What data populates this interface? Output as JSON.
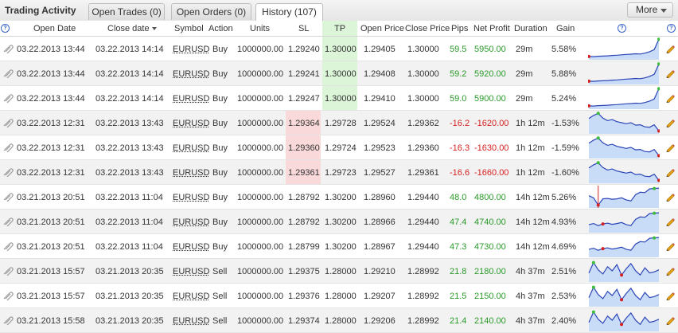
{
  "app": {
    "title": "Trading Activity"
  },
  "tabs": [
    {
      "label": "Open Trades (0)",
      "active": false
    },
    {
      "label": "Open Orders (0)",
      "active": false
    },
    {
      "label": "History (107)",
      "active": true
    }
  ],
  "more_button": {
    "label": "More"
  },
  "columns": {
    "open_date": "Open Date",
    "close_date": "Close date",
    "symbol": "Symbol",
    "action": "Action",
    "units": "Units",
    "sl": "SL",
    "tp": "TP",
    "open_price": "Open Price",
    "close_price": "Close Price",
    "pips": "Pips",
    "net_profit": "Net Profit",
    "duration": "Duration",
    "gain": "Gain"
  },
  "colors": {
    "positive": "#2a9a2a",
    "negative": "#d62020",
    "sl_highlight": "#f9d9d9",
    "tp_highlight": "#dcf5d8",
    "chart_line": "#2b45b8",
    "chart_fill": "#c9dcf7"
  },
  "icons": {
    "help": "question-circle-icon",
    "row": "paperclip-icon",
    "edit": "pencil-icon",
    "sort": "sort-descending-icon"
  },
  "rows": [
    {
      "open_date": "03.22.2013 13:44",
      "close_date": "03.22.2013 14:14",
      "symbol": "EURUSD",
      "action": "Buy",
      "units": "1000000.00",
      "sl": "1.29240",
      "tp": "1.30000",
      "open_price": "1.29405",
      "close_price": "1.30000",
      "pips": "59.5",
      "net_profit": "5950.00",
      "duration": "29m",
      "gain": "5.58%",
      "hit": "tp",
      "profit_sign": "pos",
      "spark": [
        0.12,
        0.11,
        0.13,
        0.14,
        0.15,
        0.17,
        0.18,
        0.2,
        0.22,
        0.23,
        0.25,
        0.24,
        0.28,
        0.35,
        0.45,
        0.95
      ],
      "spark_min": 0,
      "spark_max": 15
    },
    {
      "open_date": "03.22.2013 13:44",
      "close_date": "03.22.2013 14:14",
      "symbol": "EURUSD",
      "action": "Buy",
      "units": "1000000.00",
      "sl": "1.29241",
      "tp": "1.30000",
      "open_price": "1.29408",
      "close_price": "1.30000",
      "pips": "59.2",
      "net_profit": "5920.00",
      "duration": "29m",
      "gain": "5.88%",
      "hit": "tp",
      "profit_sign": "pos",
      "spark": [
        0.12,
        0.11,
        0.13,
        0.14,
        0.15,
        0.17,
        0.18,
        0.2,
        0.22,
        0.23,
        0.25,
        0.24,
        0.28,
        0.35,
        0.45,
        0.95
      ],
      "spark_min": 0,
      "spark_max": 15
    },
    {
      "open_date": "03.22.2013 13:44",
      "close_date": "03.22.2013 14:14",
      "symbol": "EURUSD",
      "action": "Buy",
      "units": "1000000.00",
      "sl": "1.29247",
      "tp": "1.30000",
      "open_price": "1.29410",
      "close_price": "1.30000",
      "pips": "59.0",
      "net_profit": "5900.00",
      "duration": "29m",
      "gain": "5.24%",
      "hit": "tp",
      "profit_sign": "pos",
      "spark": [
        0.12,
        0.11,
        0.13,
        0.14,
        0.15,
        0.17,
        0.18,
        0.2,
        0.22,
        0.23,
        0.25,
        0.24,
        0.28,
        0.35,
        0.45,
        0.95
      ],
      "spark_min": 0,
      "spark_max": 15
    },
    {
      "open_date": "03.22.2013 12:31",
      "close_date": "03.22.2013 13:43",
      "symbol": "EURUSD",
      "action": "Buy",
      "units": "1000000.00",
      "sl": "1.29364",
      "tp": "1.29728",
      "open_price": "1.29524",
      "close_price": "1.29362",
      "pips": "-16.2",
      "net_profit": "-1620.00",
      "duration": "1h 12m",
      "gain": "-1.53%",
      "hit": "sl",
      "profit_sign": "neg",
      "spark": [
        0.7,
        0.85,
        0.95,
        0.72,
        0.6,
        0.65,
        0.55,
        0.5,
        0.45,
        0.5,
        0.38,
        0.4,
        0.3,
        0.28,
        0.4,
        0.1
      ],
      "spark_min": 15,
      "spark_max": 2
    },
    {
      "open_date": "03.22.2013 12:31",
      "close_date": "03.22.2013 13:43",
      "symbol": "EURUSD",
      "action": "Buy",
      "units": "1000000.00",
      "sl": "1.29360",
      "tp": "1.29724",
      "open_price": "1.29523",
      "close_price": "1.29360",
      "pips": "-16.3",
      "net_profit": "-1630.00",
      "duration": "1h 12m",
      "gain": "-1.59%",
      "hit": "sl",
      "profit_sign": "neg",
      "spark": [
        0.7,
        0.85,
        0.95,
        0.72,
        0.6,
        0.65,
        0.55,
        0.5,
        0.45,
        0.5,
        0.38,
        0.4,
        0.3,
        0.28,
        0.4,
        0.1
      ],
      "spark_min": 15,
      "spark_max": 2
    },
    {
      "open_date": "03.22.2013 12:31",
      "close_date": "03.22.2013 13:43",
      "symbol": "EURUSD",
      "action": "Buy",
      "units": "1000000.00",
      "sl": "1.29361",
      "tp": "1.29723",
      "open_price": "1.29527",
      "close_price": "1.29361",
      "pips": "-16.6",
      "net_profit": "-1660.00",
      "duration": "1h 12m",
      "gain": "-1.60%",
      "hit": "sl",
      "profit_sign": "neg",
      "spark": [
        0.7,
        0.85,
        0.95,
        0.72,
        0.6,
        0.65,
        0.55,
        0.5,
        0.45,
        0.5,
        0.38,
        0.4,
        0.3,
        0.28,
        0.4,
        0.1
      ],
      "spark_min": 15,
      "spark_max": 2
    },
    {
      "open_date": "03.21.2013 20:51",
      "close_date": "03.22.2013 11:04",
      "symbol": "EURUSD",
      "action": "Buy",
      "units": "1000000.00",
      "sl": "1.28792",
      "tp": "1.30200",
      "open_price": "1.28960",
      "close_price": "1.29440",
      "pips": "48.0",
      "net_profit": "4800.00",
      "duration": "14h 12m",
      "gain": "5.26%",
      "hit": "",
      "profit_sign": "pos",
      "spark": [
        0.55,
        0.45,
        0.1,
        0.4,
        0.42,
        0.38,
        0.4,
        0.45,
        0.35,
        0.3,
        0.6,
        0.72,
        0.7,
        0.88,
        0.9,
        0.92
      ],
      "spark_min": 2,
      "spark_max": 14,
      "spike": true
    },
    {
      "open_date": "03.21.2013 20:51",
      "close_date": "03.22.2013 11:04",
      "symbol": "EURUSD",
      "action": "Buy",
      "units": "1000000.00",
      "sl": "1.28792",
      "tp": "1.30200",
      "open_price": "1.28966",
      "close_price": "1.29440",
      "pips": "47.4",
      "net_profit": "4740.00",
      "duration": "14h 12m",
      "gain": "4.93%",
      "hit": "",
      "profit_sign": "pos",
      "spark": [
        0.35,
        0.4,
        0.3,
        0.38,
        0.42,
        0.36,
        0.4,
        0.45,
        0.35,
        0.3,
        0.6,
        0.72,
        0.7,
        0.88,
        0.9,
        0.92
      ],
      "spark_min": 3,
      "spark_max": 14
    },
    {
      "open_date": "03.21.2013 20:51",
      "close_date": "03.22.2013 11:04",
      "symbol": "EURUSD",
      "action": "Buy",
      "units": "1000000.00",
      "sl": "1.28799",
      "tp": "1.30200",
      "open_price": "1.28967",
      "close_price": "1.29440",
      "pips": "47.3",
      "net_profit": "4730.00",
      "duration": "14h 12m",
      "gain": "4.69%",
      "hit": "",
      "profit_sign": "pos",
      "spark": [
        0.35,
        0.4,
        0.3,
        0.38,
        0.42,
        0.36,
        0.4,
        0.45,
        0.35,
        0.3,
        0.6,
        0.72,
        0.7,
        0.88,
        0.9,
        0.92
      ],
      "spark_min": 3,
      "spark_max": 14
    },
    {
      "open_date": "03.21.2013 15:57",
      "close_date": "03.21.2013 20:35",
      "symbol": "EURUSD",
      "action": "Sell",
      "units": "1000000.00",
      "sl": "1.29375",
      "tp": "1.28000",
      "open_price": "1.29210",
      "close_price": "1.28992",
      "pips": "21.8",
      "net_profit": "2180.00",
      "duration": "4h 37m",
      "gain": "2.51%",
      "hit": "",
      "profit_sign": "pos",
      "spark": [
        0.4,
        0.9,
        0.55,
        0.35,
        0.7,
        0.5,
        0.8,
        0.3,
        0.6,
        0.85,
        0.5,
        0.3,
        0.65,
        0.4,
        0.45,
        0.55
      ],
      "spark_min": 7,
      "spark_max": 1
    },
    {
      "open_date": "03.21.2013 15:57",
      "close_date": "03.21.2013 20:35",
      "symbol": "EURUSD",
      "action": "Sell",
      "units": "1000000.00",
      "sl": "1.29376",
      "tp": "1.28000",
      "open_price": "1.29207",
      "close_price": "1.28992",
      "pips": "21.5",
      "net_profit": "2150.00",
      "duration": "4h 37m",
      "gain": "2.53%",
      "hit": "",
      "profit_sign": "pos",
      "spark": [
        0.4,
        0.9,
        0.55,
        0.35,
        0.7,
        0.5,
        0.8,
        0.3,
        0.6,
        0.85,
        0.5,
        0.3,
        0.65,
        0.4,
        0.45,
        0.55
      ],
      "spark_min": 7,
      "spark_max": 1
    },
    {
      "open_date": "03.21.2013 15:58",
      "close_date": "03.21.2013 20:35",
      "symbol": "EURUSD",
      "action": "Sell",
      "units": "1000000.00",
      "sl": "1.29374",
      "tp": "1.28000",
      "open_price": "1.29206",
      "close_price": "1.28992",
      "pips": "21.4",
      "net_profit": "2140.00",
      "duration": "4h 37m",
      "gain": "2.40%",
      "hit": "",
      "profit_sign": "pos",
      "spark": [
        0.4,
        0.9,
        0.55,
        0.35,
        0.7,
        0.5,
        0.8,
        0.3,
        0.6,
        0.85,
        0.5,
        0.3,
        0.65,
        0.4,
        0.45,
        0.55
      ],
      "spark_min": 7,
      "spark_max": 1
    }
  ]
}
